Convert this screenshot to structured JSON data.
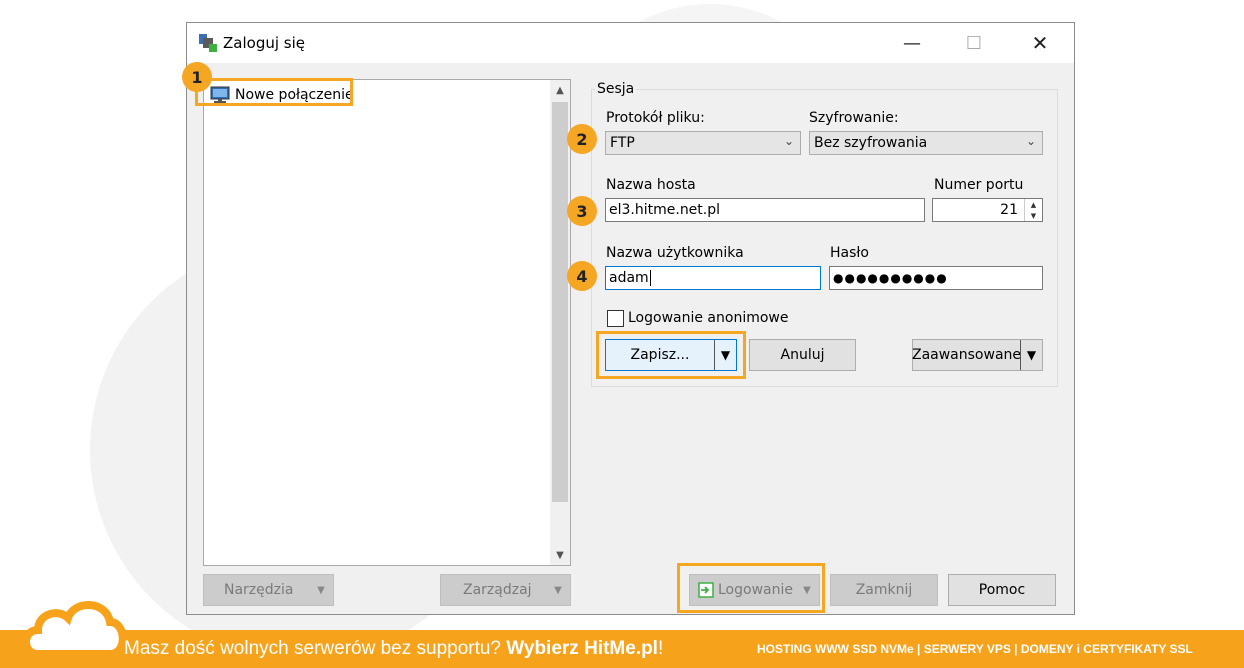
{
  "window": {
    "title": "Zaloguj się"
  },
  "tree": {
    "items": [
      {
        "label": "Nowe połączenie"
      }
    ]
  },
  "left_buttons": {
    "tools": "Narzędzia",
    "manage": "Zarządzaj"
  },
  "session": {
    "group_label": "Sesja",
    "protocol": {
      "label": "Protokół pliku:",
      "value": "FTP"
    },
    "encryption": {
      "label": "Szyfrowanie:",
      "value": "Bez szyfrowania"
    },
    "host": {
      "label": "Nazwa hosta",
      "value": "el3.hitme.net.pl"
    },
    "port": {
      "label": "Numer portu",
      "value": "21"
    },
    "username": {
      "label": "Nazwa użytkownika",
      "value": "adam"
    },
    "password": {
      "label": "Hasło",
      "value": "●●●●●●●●●●"
    },
    "anonymous": {
      "label": "Logowanie anonimowe",
      "checked": false
    },
    "save_label": "Zapisz...",
    "cancel_label": "Anuluj",
    "advanced_label": "Zaawansowane"
  },
  "bottom_buttons": {
    "login": "Logowanie",
    "close": "Zamknij",
    "help": "Pomoc"
  },
  "annotations": [
    "1",
    "2",
    "3",
    "4"
  ],
  "banner": {
    "text_main": "Masz dość wolnych serwerów bez supportu? ",
    "text_bold": "Wybierz HitMe.pl",
    "text_end": "!",
    "right": "HOSTING WWW SSD NVMe | SERWERY VPS | DOMENY i CERTYFIKATY SSL"
  },
  "colors": {
    "accent": "#f5a623",
    "banner": "#f7a21b",
    "window_bg": "#f0f0f0",
    "focus": "#0078d7"
  }
}
